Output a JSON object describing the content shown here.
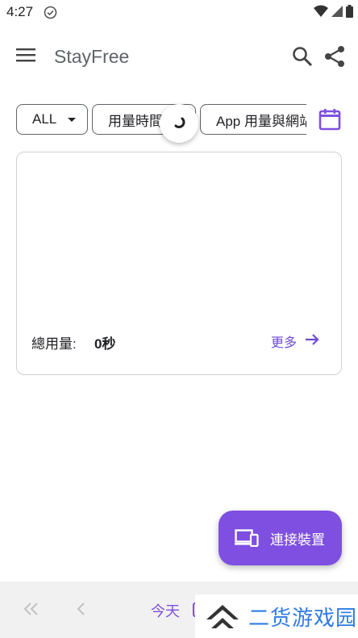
{
  "status_bar": {
    "time": "4:27"
  },
  "app_bar": {
    "title": "StayFree"
  },
  "filters": {
    "category": "ALL",
    "metric": "用量時間",
    "view": "App 用量與網站"
  },
  "summary": {
    "total_label": "總用量:",
    "total_value": "0秒",
    "more_label": "更多"
  },
  "fab": {
    "label": "連接裝置"
  },
  "bottom_nav": {
    "today_label": "今天"
  },
  "watermark": {
    "text": "二货游戏园"
  },
  "colors": {
    "accent": "#7e4fe0",
    "link": "#6e4bd8",
    "watermark": "#2f7be5"
  },
  "icons": [
    "check-circle-icon",
    "wifi-icon",
    "signal-icon",
    "battery-icon",
    "menu-icon",
    "search-icon",
    "share-icon",
    "dropdown-caret-icon",
    "loading-spinner-icon",
    "calendar-icon",
    "arrow-right-icon",
    "devices-icon",
    "double-chevron-left-icon",
    "chevron-left-icon"
  ]
}
